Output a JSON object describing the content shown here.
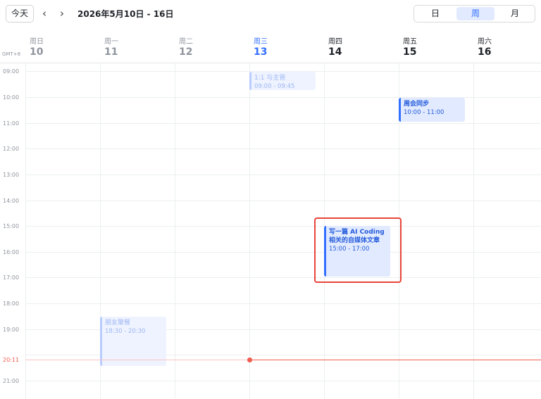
{
  "toolbar": {
    "today_label": "今天",
    "prev_icon": "chevron-left-icon",
    "next_icon": "chevron-right-icon",
    "range_label": "2026年5月10日 - 16日",
    "range_caret": "⌵",
    "views": {
      "day": "日",
      "week": "周",
      "month": "月",
      "selected": "week"
    }
  },
  "header": {
    "timezone": "GMT+8",
    "days": [
      {
        "name": "周日",
        "num": "10"
      },
      {
        "name": "周一",
        "num": "11"
      },
      {
        "name": "周二",
        "num": "12"
      },
      {
        "name": "周三",
        "num": "13"
      },
      {
        "name": "周四",
        "num": "14"
      },
      {
        "name": "周五",
        "num": "15"
      },
      {
        "name": "周六",
        "num": "16"
      }
    ]
  },
  "hours": [
    "09:00",
    "10:00",
    "11:00",
    "12:00",
    "13:00",
    "14:00",
    "15:00",
    "16:00",
    "17:00",
    "18:00",
    "19:00",
    "20:00",
    "21:00"
  ],
  "now": {
    "label": "20:11"
  },
  "events": [
    {
      "title": "1:1 与主管",
      "time": "09:00 - 09:45"
    },
    {
      "title": "周会同步",
      "time": "10:00 - 11:00"
    },
    {
      "title": "写一篇 AI Coding 相关的自媒体文章",
      "time": "15:00 - 17:00"
    },
    {
      "title": "朋友聚餐",
      "time": "18:30 - 20:30"
    }
  ],
  "colors": {
    "accent": "#3370ff",
    "event_bg": "#e1eaff",
    "now_line": "#f25b4e",
    "highlight": "#e8443a"
  }
}
